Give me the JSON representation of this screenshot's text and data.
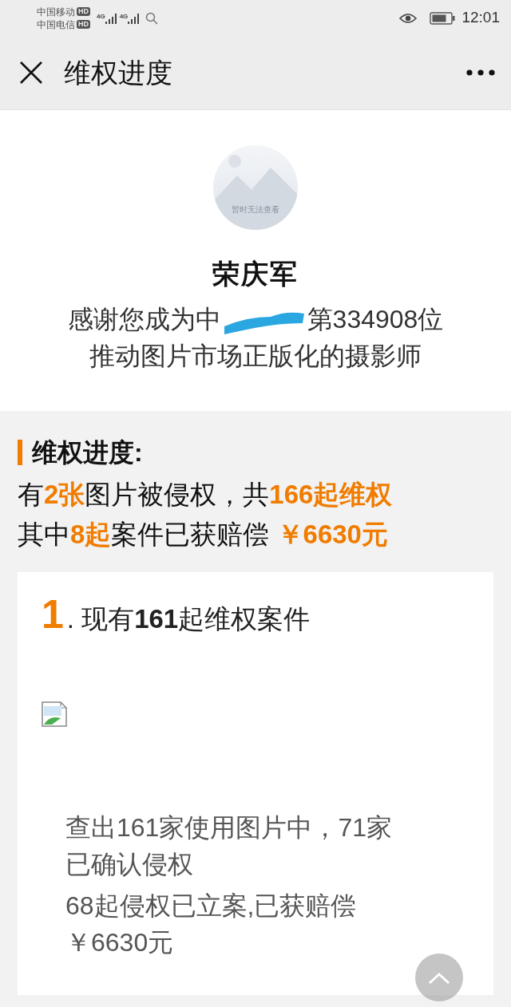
{
  "status_bar": {
    "carriers": [
      {
        "name": "中国移动",
        "badge": "HD"
      },
      {
        "name": "中国电信",
        "badge": "HD"
      }
    ],
    "network_labels": [
      "4G",
      "4G"
    ],
    "time": "12:01"
  },
  "header": {
    "title": "维权进度"
  },
  "profile": {
    "avatar_placeholder": "暂时无法查看",
    "name": "荣庆军",
    "thanks_before": "感谢您成为中",
    "thanks_after": "第334908位",
    "thanks_line2": "推动图片市场正版化的摄影师"
  },
  "progress": {
    "heading": "维权进度:",
    "lines": [
      "有**2张**图片被侵权，共**166起维权**",
      "其中**8起**案件已获赔偿 **￥6630元**"
    ]
  },
  "cases": [
    {
      "number": "1",
      "title": ". 现有**161**起维权案件",
      "details": [
        "查出161家使用图片中，71家已确认侵权",
        "68起侵权已立案,已获赔偿￥6630元"
      ]
    }
  ]
}
